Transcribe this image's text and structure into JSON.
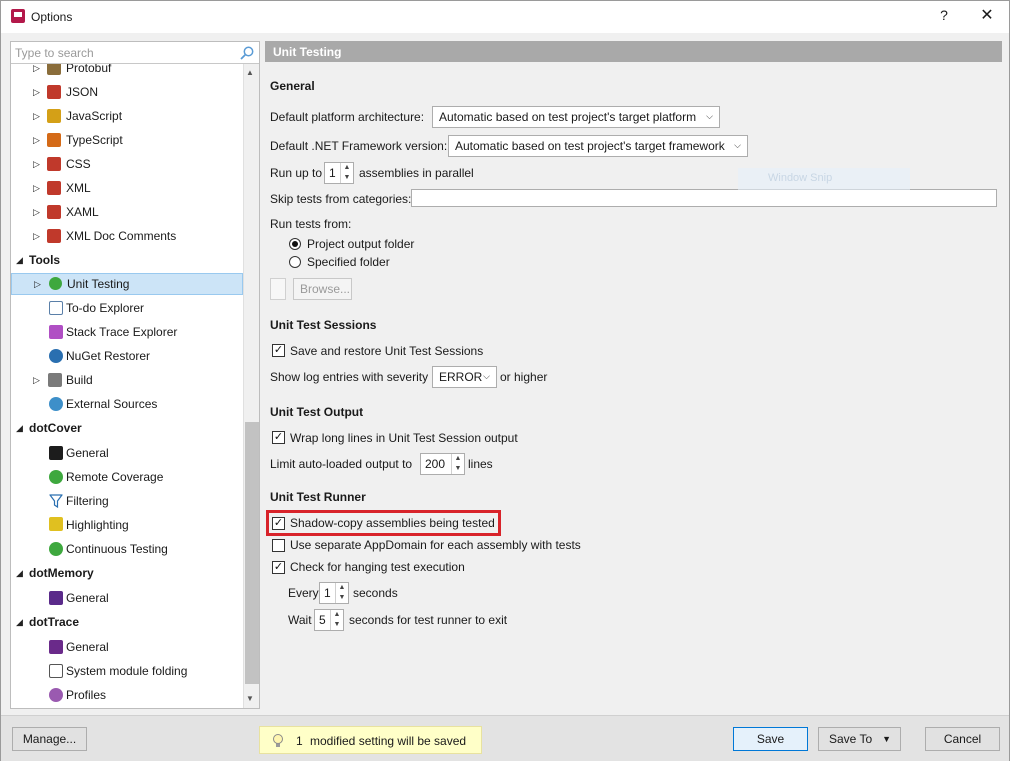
{
  "window": {
    "title": "Options",
    "help": "?",
    "close": "✕"
  },
  "search": {
    "placeholder": "Type to search"
  },
  "tree": {
    "items": [
      {
        "label": "Protobuf",
        "icon_color": "#8a6d3b"
      },
      {
        "label": "JSON",
        "icon_color": "#c0392b"
      },
      {
        "label": "JavaScript",
        "icon_color": "#d4a017"
      },
      {
        "label": "TypeScript",
        "icon_color": "#d46a17"
      },
      {
        "label": "CSS",
        "icon_color": "#c0392b"
      },
      {
        "label": "XML",
        "icon_color": "#c0392b"
      },
      {
        "label": "XAML",
        "icon_color": "#c0392b"
      },
      {
        "label": "XML Doc Comments",
        "icon_color": "#c0392b"
      }
    ],
    "groups": {
      "tools": "Tools",
      "dotcover": "dotCover",
      "dotmemory": "dotMemory",
      "dottrace": "dotTrace"
    },
    "tools_items": [
      {
        "label": "Unit Testing"
      },
      {
        "label": "To-do Explorer"
      },
      {
        "label": "Stack Trace Explorer"
      },
      {
        "label": "NuGet Restorer"
      },
      {
        "label": "Build"
      },
      {
        "label": "External Sources"
      }
    ],
    "dotcover_items": [
      {
        "label": "General"
      },
      {
        "label": "Remote Coverage"
      },
      {
        "label": "Filtering"
      },
      {
        "label": "Highlighting"
      },
      {
        "label": "Continuous Testing"
      }
    ],
    "dotmemory_items": [
      {
        "label": "General"
      }
    ],
    "dottrace_items": [
      {
        "label": "General"
      },
      {
        "label": "System module folding"
      },
      {
        "label": "Profiles"
      }
    ]
  },
  "page": {
    "header": "Unit Testing",
    "general": {
      "title": "General",
      "platform_label": "Default platform architecture:",
      "platform_value": "Automatic based on test project's target platform",
      "framework_label": "Default .NET Framework version:",
      "framework_value": "Automatic based on test project's target framework",
      "runup_prefix": "Run up to",
      "runup_value": "1",
      "runup_suffix": "assemblies in parallel",
      "skip_label": "Skip tests from categories:",
      "skip_value": "",
      "run_from_label": "Run tests from:",
      "radio_project": "Project output folder",
      "radio_specified": "Specified folder",
      "browse": "Browse..."
    },
    "sessions": {
      "title": "Unit Test Sessions",
      "save_restore": "Save and restore Unit Test Sessions",
      "log_label": "Show log entries with severity",
      "log_value": "ERROR",
      "log_suffix": "or higher"
    },
    "output": {
      "title": "Unit Test Output",
      "wrap": "Wrap long lines in Unit Test Session output",
      "limit_prefix": "Limit auto-loaded output to",
      "limit_value": "200",
      "limit_suffix": "lines"
    },
    "runner": {
      "title": "Unit Test Runner",
      "shadow_copy": "Shadow-copy assemblies being tested",
      "separate_appdomain": "Use separate AppDomain for each assembly with tests",
      "check_hanging": "Check for hanging test execution",
      "every_prefix": "Every",
      "every_value": "1",
      "every_suffix": "seconds",
      "wait_prefix": "Wait",
      "wait_value": "5",
      "wait_suffix": "seconds for test runner to exit"
    },
    "watermark": "Window Snip"
  },
  "footer": {
    "manage": "Manage...",
    "info_count": "1",
    "info_text": "modified setting will be saved",
    "save": "Save",
    "save_to": "Save To",
    "cancel": "Cancel"
  },
  "colors": {
    "accent": "#0078d7",
    "highlight": "#d8232a",
    "header_bg": "#a9a9a9",
    "selection": "#cce4f7"
  }
}
